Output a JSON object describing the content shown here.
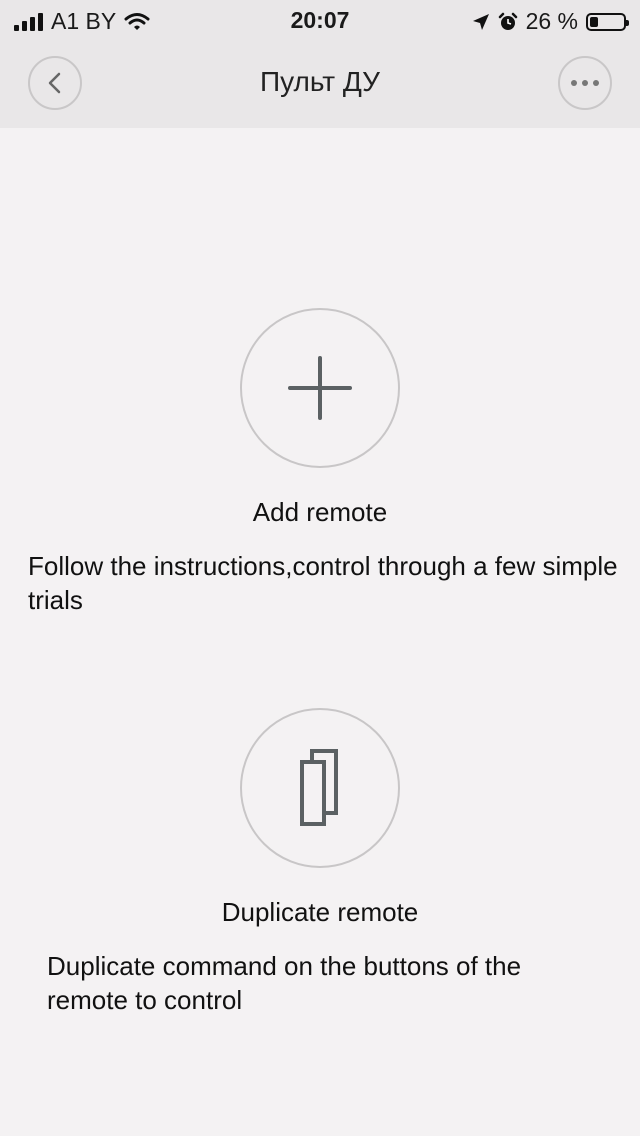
{
  "status": {
    "carrier": "A1 BY",
    "time": "20:07",
    "battery": "26 %",
    "battery_level": 0.26
  },
  "nav": {
    "title": "Пульт ДУ"
  },
  "actions": [
    {
      "title": "Add remote",
      "description": "Follow the instructions,control through a few simple trials"
    },
    {
      "title": "Duplicate remote",
      "description": "Duplicate command on the buttons of the remote to control"
    }
  ]
}
